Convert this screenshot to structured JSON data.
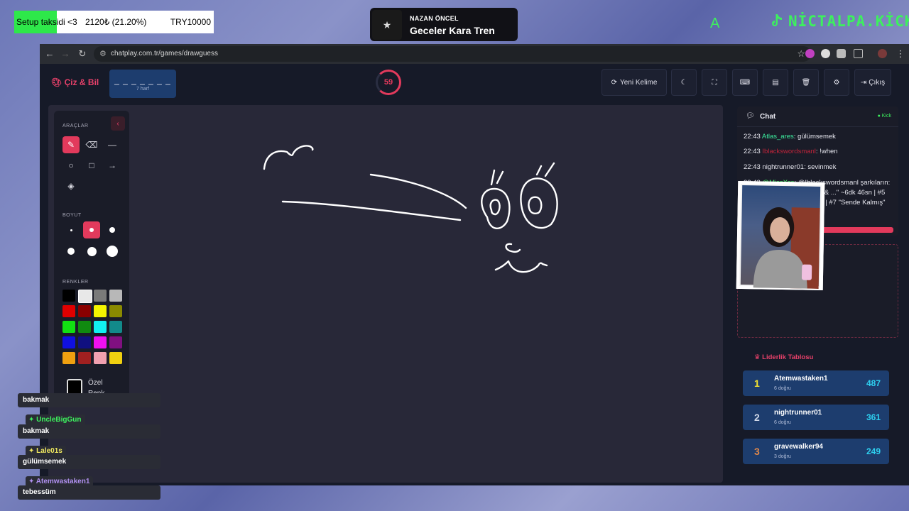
{
  "overlay": {
    "goal_label": "Setup taksidi <3",
    "goal_amount": "2120₺ (21.20%)",
    "goal_target": "TRY10000",
    "goal_progress": 0.212,
    "song_artist": "NAZAN ÖNCEL",
    "song_title": "Geceler Kara Tren",
    "corner_letter": "A",
    "brand": "NİCTALPA.KİCK"
  },
  "browser": {
    "url": "chatplay.com.tr/games/drawguess"
  },
  "app": {
    "logo": "Çiz & Bil",
    "word_mask": "_ _ _ _ _ _ _",
    "word_length": "7 harf",
    "timer": "59",
    "new_word": "Yeni Kelime",
    "exit": "Çıkış"
  },
  "tools": {
    "tools_label": "ARAÇLAR",
    "size_label": "BOYUT",
    "colors_label": "RENKLER",
    "custom_color": "Özel Renk",
    "colors": [
      "#000000",
      "#e8e8e8",
      "#7a7a7a",
      "#b8b8b8",
      "#e00000",
      "#8a0000",
      "#f4f400",
      "#8a8a00",
      "#12e012",
      "#108a10",
      "#12f0f0",
      "#128a8a",
      "#1010e0",
      "#101080",
      "#f010f0",
      "#801080",
      "#f0a010",
      "#a02020",
      "#f0a0b0",
      "#f0d010"
    ]
  },
  "chat": {
    "title": "Chat",
    "platform": "Kick",
    "messages": [
      {
        "time": "22:43",
        "user": "Atlas_ares",
        "color": "#3df0a0",
        "text": ": gülümsemek"
      },
      {
        "time": "22:43",
        "user": "Iblackswordsmanl",
        "color": "#c0243a",
        "text": ": !when"
      },
      {
        "time": "22:43",
        "user": "nightrunner01",
        "color": "#e6e6ee",
        "text": ": sevinmek"
      },
      {
        "time": "22:43",
        "user": "@MissXss",
        "color": "#3df05e",
        "text": ": @Iblackswordsmanl şarkıların: #2 \"Play Hard (feat. Ne-Yo & ...\" ~6dk 46sn | #5 \"Tükeneceğiz\" ~17dk 16sn | #7 \"Sende Kalmış\" ~25dk 24sn"
      }
    ]
  },
  "leaderboard": {
    "title": "Liderlik Tablosu",
    "rows": [
      {
        "rank": "1",
        "name": "Atemwastaken1",
        "sub": "6 doğru",
        "score": "487",
        "color": "#f0e030"
      },
      {
        "rank": "2",
        "name": "nightrunner01",
        "sub": "6 doğru",
        "score": "361",
        "color": "#d0d8e8"
      },
      {
        "rank": "3",
        "name": "gravewalker94",
        "sub": "3 doğru",
        "score": "249",
        "color": "#e0884a"
      }
    ]
  },
  "stream_chat": [
    {
      "name": "",
      "msg": "bakmak"
    },
    {
      "name": "UncleBigGun",
      "color": "#3df05e",
      "msg": "bakmak"
    },
    {
      "name": "Lale01s",
      "color": "#f0e860",
      "msg": "gülümsemek"
    },
    {
      "name": "Atemwastaken1",
      "color": "#b090f0",
      "msg": "tebessüm"
    }
  ]
}
